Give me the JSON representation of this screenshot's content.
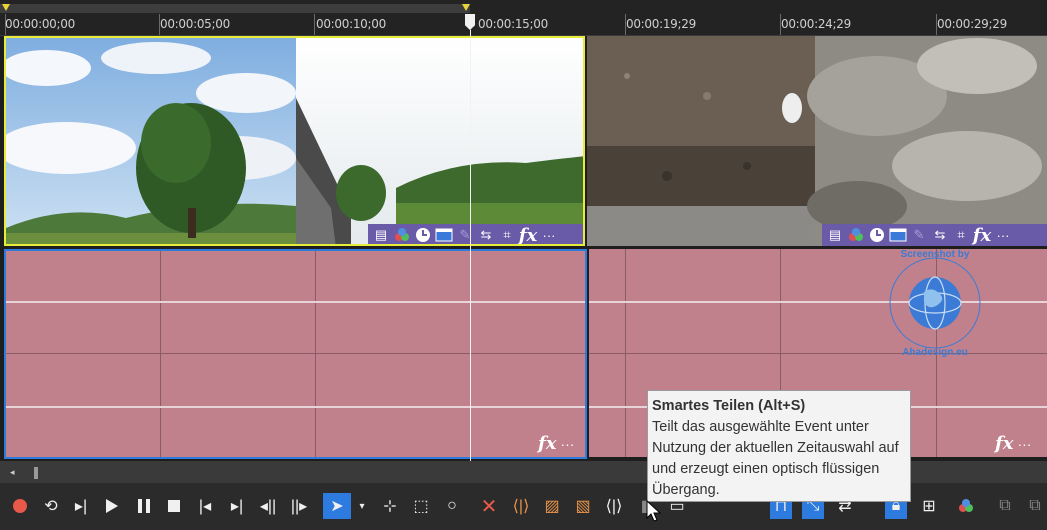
{
  "ruler": {
    "labels": [
      "00:00:00;00",
      "00:00:05;00",
      "00:00:10;00",
      "00:00:15;00",
      "00:00:19;29",
      "00:00:24;29",
      "00:00:29;29"
    ]
  },
  "clip_toolbar_icons": [
    "pan-crop-fx-icon",
    "color-wheel-icon",
    "clock-icon",
    "window-icon",
    "pencil-icon",
    "swap-icon",
    "crop-icon",
    "fx-icon",
    "more-icon"
  ],
  "fx_label": "fx",
  "more_label": "···",
  "tooltip": {
    "title": "Smartes Teilen (Alt+S)",
    "body": "Teilt das ausgewählte Event unter Nutzung der aktuellen Zeitauswahl auf und erzeugt einen optisch flüssigen Übergang."
  },
  "watermark": {
    "top_text": "Screenshot by",
    "bottom_text": "Ahadesign.eu"
  },
  "colors": {
    "selected_video_border": "#e7ec3a",
    "selected_audio_border": "#2e7be0",
    "audio_clip": "#c0818c",
    "clip_toolbar": "#6a5ba8",
    "record": "#e8594a",
    "delete": "#e8594a",
    "accent_blue": "#2e7be0"
  }
}
